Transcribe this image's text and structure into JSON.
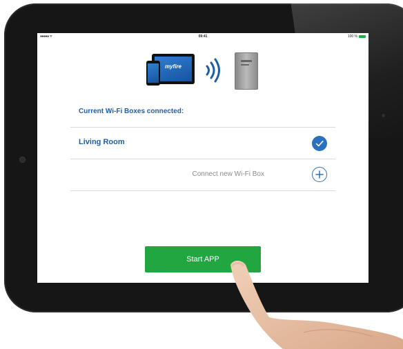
{
  "statusbar": {
    "signal": "●●●●● ᯤ",
    "time": "09:41",
    "battery_text": "100 %"
  },
  "illustration": {
    "brand_text": "myfire"
  },
  "section": {
    "title": "Current Wi-Fi Boxes connected:"
  },
  "boxes": [
    {
      "label": "Living Room",
      "icon": "checkmark-icon"
    }
  ],
  "connect": {
    "label": "Connect new Wi-Fi Box",
    "icon": "plus-icon"
  },
  "start_button": {
    "label": "Start APP"
  },
  "colors": {
    "accent": "#1d5fa5",
    "check_fill": "#2b6fbf",
    "button": "#21a642",
    "muted_text": "#8a8a8a"
  }
}
